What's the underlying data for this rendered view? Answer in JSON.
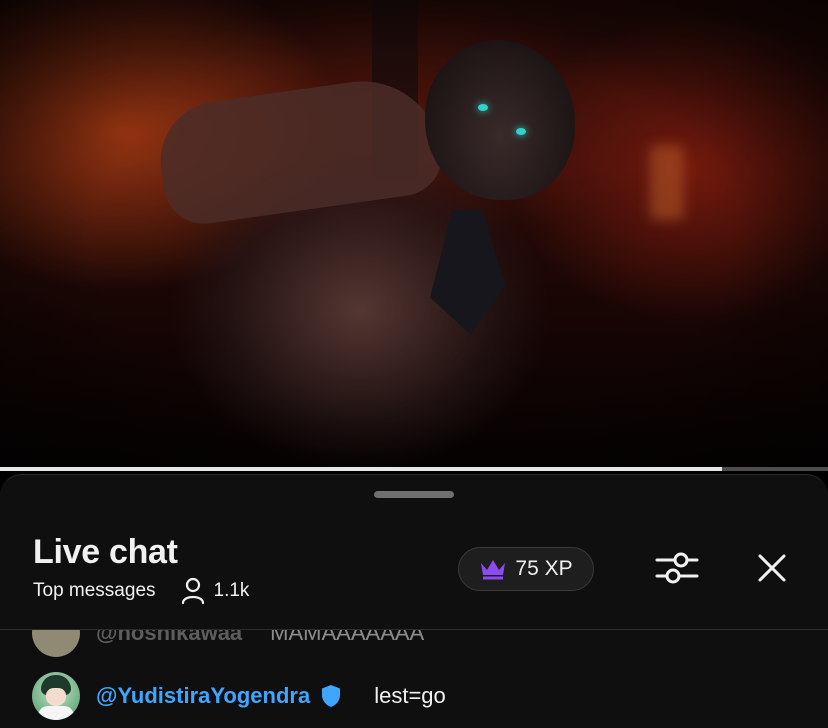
{
  "video": {
    "progress_fraction": 0.872
  },
  "chat": {
    "title": "Live chat",
    "mode": "Top messages",
    "viewer_count": "1.1k",
    "xp_label": "75 XP",
    "messages": [
      {
        "author": "@hoshikawaa",
        "text": "MAMAAAAAAA"
      },
      {
        "author": "@YudistiraYogendra",
        "text": "lest=go"
      }
    ]
  },
  "icons": {
    "viewer": "person-icon",
    "xp": "crown-icon",
    "filter": "sliders-icon",
    "close": "close-icon",
    "verified": "shield-check-icon"
  },
  "colors": {
    "panel_bg": "#0f0f0f",
    "author_blue": "#3ea6ff",
    "crown_purple": "#8a4cf0",
    "text_primary": "#f1f1f1"
  }
}
